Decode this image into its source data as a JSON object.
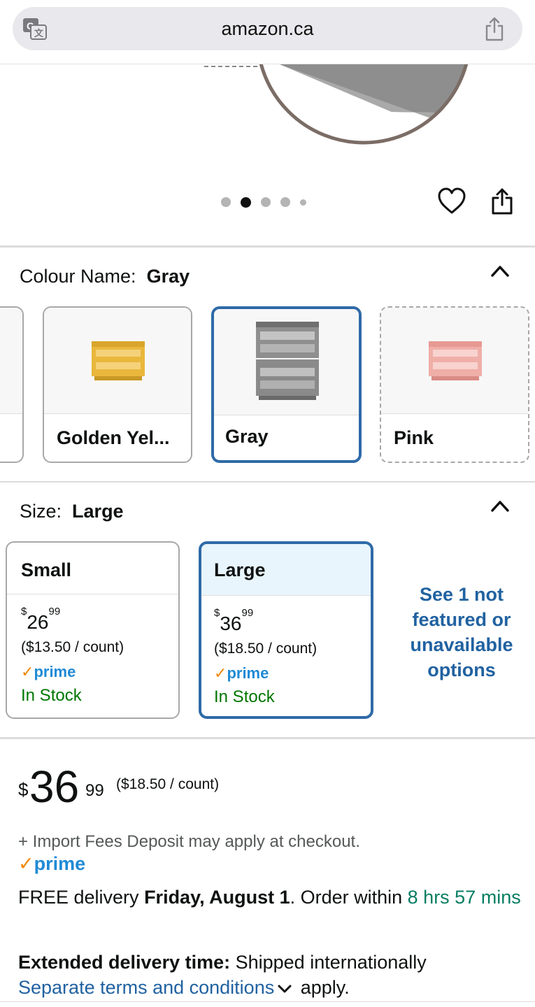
{
  "browser": {
    "url": "amazon.ca",
    "icons": [
      "translate-icon",
      "share-icon"
    ]
  },
  "gallery": {
    "dots": 5,
    "active_dot_index": 1,
    "icons": [
      "heart-icon",
      "share-icon"
    ]
  },
  "colour": {
    "label": "Colour Name:",
    "selected": "Gray",
    "options": [
      {
        "name": "",
        "state": "partial"
      },
      {
        "name": "Golden Yel...",
        "state": "available",
        "color": "#e7b93c"
      },
      {
        "name": "Gray",
        "state": "selected",
        "color": "#8a8a8a"
      },
      {
        "name": "Pink",
        "state": "unavailable",
        "color": "#f1b2ad"
      }
    ]
  },
  "size": {
    "label": "Size:",
    "selected": "Large",
    "options": [
      {
        "name": "Small",
        "dollars": "26",
        "cents": "99",
        "currency": "$",
        "per_count": "($13.50 / count)",
        "prime": "prime",
        "stock": "In Stock"
      },
      {
        "name": "Large",
        "dollars": "36",
        "cents": "99",
        "currency": "$",
        "per_count": "($18.50 / count)",
        "prime": "prime",
        "stock": "In Stock"
      }
    ],
    "see_more": "See 1 not featured or unavailable options"
  },
  "buybox": {
    "currency": "$",
    "dollars": "36",
    "cents": "99",
    "per_count": "($18.50 / count)",
    "import_note": "+ Import Fees Deposit may apply at checkout.",
    "prime": "prime",
    "delivery_prefix": "FREE delivery ",
    "delivery_date": "Friday, August 1",
    "delivery_mid": ". Order within ",
    "countdown": "8 hrs 57 mins",
    "extended_label": "Extended delivery time:",
    "extended_text": " Shipped internationally",
    "terms_link": "Separate terms and conditions",
    "terms_suffix": " apply."
  },
  "colors": {
    "link": "#2162a1",
    "selected_border": "#2f6aa8",
    "in_stock": "#007600",
    "prime_blue": "#1f8ad6",
    "prime_check": "#f08804"
  }
}
